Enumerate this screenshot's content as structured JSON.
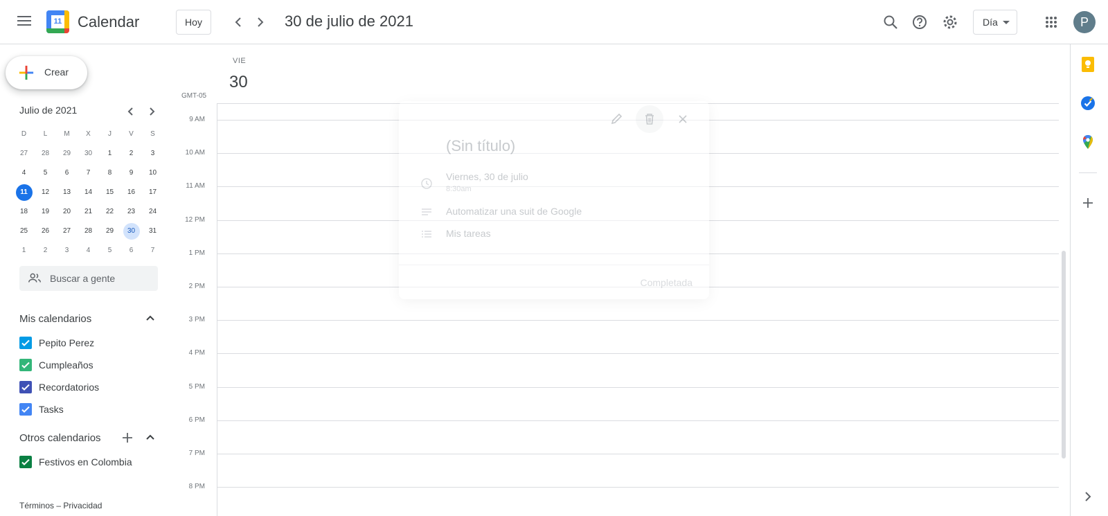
{
  "header": {
    "app_title": "Calendar",
    "logo_day": "11",
    "today_label": "Hoy",
    "date_title": "30 de julio de 2021",
    "view_label": "Día",
    "avatar_initial": "P",
    "icons": [
      "menu-icon",
      "search-icon",
      "help-icon",
      "settings-icon",
      "apps-icon"
    ]
  },
  "sidebar": {
    "create_label": "Crear",
    "mini_calendar": {
      "title": "Julio de 2021",
      "weekdays": [
        "D",
        "L",
        "M",
        "X",
        "J",
        "V",
        "S"
      ],
      "weeks": [
        [
          "27",
          "28",
          "29",
          "30",
          "1",
          "2",
          "3"
        ],
        [
          "4",
          "5",
          "6",
          "7",
          "8",
          "9",
          "10"
        ],
        [
          "11",
          "12",
          "13",
          "14",
          "15",
          "16",
          "17"
        ],
        [
          "18",
          "19",
          "20",
          "21",
          "22",
          "23",
          "24"
        ],
        [
          "25",
          "26",
          "27",
          "28",
          "29",
          "30",
          "31"
        ],
        [
          "1",
          "2",
          "3",
          "4",
          "5",
          "6",
          "7"
        ]
      ],
      "today": "11",
      "selected": "30"
    },
    "search_people_placeholder": "Buscar a gente",
    "my_calendars_title": "Mis calendarios",
    "my_calendars": [
      {
        "label": "Pepito Perez",
        "color": "#039be5"
      },
      {
        "label": "Cumpleaños",
        "color": "#33b679"
      },
      {
        "label": "Recordatorios",
        "color": "#3f51b5"
      },
      {
        "label": "Tasks",
        "color": "#4285f4"
      }
    ],
    "other_calendars_title": "Otros calendarios",
    "other_calendars": [
      {
        "label": "Festivos en Colombia",
        "color": "#0b8043"
      }
    ],
    "footer": {
      "terms": "Términos",
      "separator": "–",
      "privacy": "Privacidad"
    }
  },
  "main": {
    "day_label": "VIE",
    "day_number": "30",
    "timezone": "GMT-05",
    "hours": [
      "9 AM",
      "10 AM",
      "11 AM",
      "12 PM",
      "1 PM",
      "2 PM",
      "3 PM",
      "4 PM",
      "5 PM",
      "6 PM",
      "7 PM",
      "8 PM"
    ]
  },
  "event_card": {
    "title": "(Sin título)",
    "date": "Viernes, 30 de julio",
    "time": "8:30am",
    "description": "Automatizar una suit de Google",
    "list": "Mis tareas",
    "action_label": "Completada"
  },
  "right_rail": {
    "icons": [
      "keep-icon",
      "tasks-icon",
      "maps-icon",
      "add-icon",
      "expand-icon"
    ],
    "keep_color": "#fbbc04",
    "tasks_color": "#1a73e8"
  }
}
